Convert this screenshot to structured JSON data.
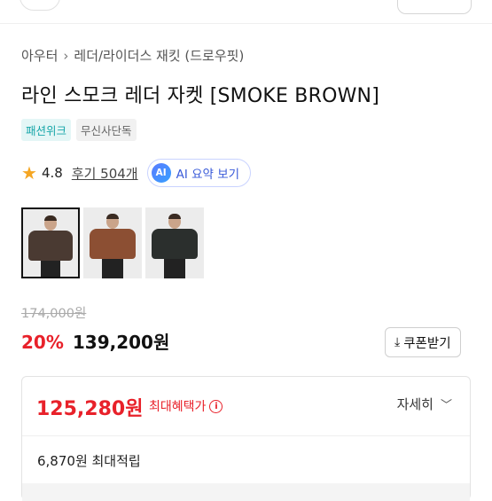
{
  "breadcrumb": [
    "아우터",
    "레더/라이더스 재킷 (드로우핏)"
  ],
  "product": {
    "title": "라인 스모크 레더 자켓 [SMOKE BROWN]",
    "badges": [
      "패션위크",
      "무신사단독"
    ],
    "rating": "4.8",
    "review_link": "후기 504개",
    "ai_summary_icon": "AI",
    "ai_summary_label": "AI 요약 보기",
    "thumbnails": [
      {
        "jacket": "#4a3a32",
        "bg": "#ececec"
      },
      {
        "jacket": "#8c4f33",
        "bg": "#ececec"
      },
      {
        "jacket": "#2b2f2d",
        "bg": "#ececec"
      }
    ]
  },
  "price": {
    "original": "174,000원",
    "discount": "20%",
    "sale": "139,200원",
    "coupon_label": "쿠폰받기"
  },
  "benefit": {
    "max_price": "125,280원",
    "max_label": "최대혜택가",
    "detail_label": "자세히",
    "points": "6,870원 최대적립"
  },
  "colors": {
    "accent_red": "#e8212a",
    "teal": "#17a6a9",
    "ai_blue": "#3a5bd9"
  },
  "icons": [
    "chevron-right-icon",
    "star-icon",
    "ai-icon",
    "download-icon",
    "info-icon",
    "chevron-down-icon"
  ]
}
